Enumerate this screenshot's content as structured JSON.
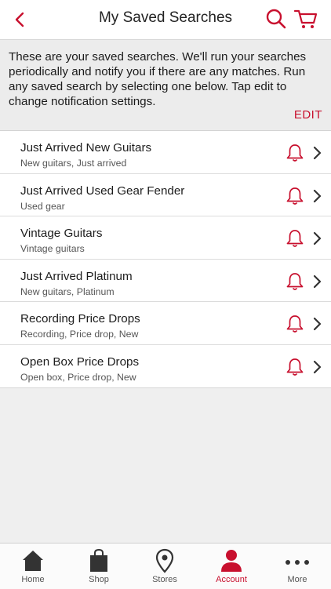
{
  "header": {
    "title": "My Saved Searches",
    "back_icon": "chevron-left-icon",
    "search_icon": "search-icon",
    "cart_icon": "cart-icon"
  },
  "intro": {
    "text": "These are your saved searches. We'll run your searches periodically and notify you if there are any matches. Run any saved search by selecting one below. Tap edit to change notification settings.",
    "edit_label": "EDIT"
  },
  "searches": [
    {
      "name": "Just Arrived New Guitars",
      "sub": "New guitars, Just arrived"
    },
    {
      "name": "Just Arrived Used Gear Fender",
      "sub": "Used gear"
    },
    {
      "name": "Vintage Guitars",
      "sub": "Vintage guitars"
    },
    {
      "name": "Just Arrived Platinum",
      "sub": "New guitars, Platinum"
    },
    {
      "name": "Recording Price Drops",
      "sub": "Recording, Price drop, New"
    },
    {
      "name": "Open Box Price Drops",
      "sub": "Open box, Price drop, New"
    }
  ],
  "tabs": [
    {
      "label": "Home",
      "icon": "home-icon"
    },
    {
      "label": "Shop",
      "icon": "shopping-bag-icon"
    },
    {
      "label": "Stores",
      "icon": "location-pin-icon"
    },
    {
      "label": "Account",
      "icon": "person-icon"
    },
    {
      "label": "More",
      "icon": "more-dots-icon"
    }
  ],
  "colors": {
    "accent": "#c8102e",
    "text": "#1a1a1a",
    "background": "#efefef"
  }
}
